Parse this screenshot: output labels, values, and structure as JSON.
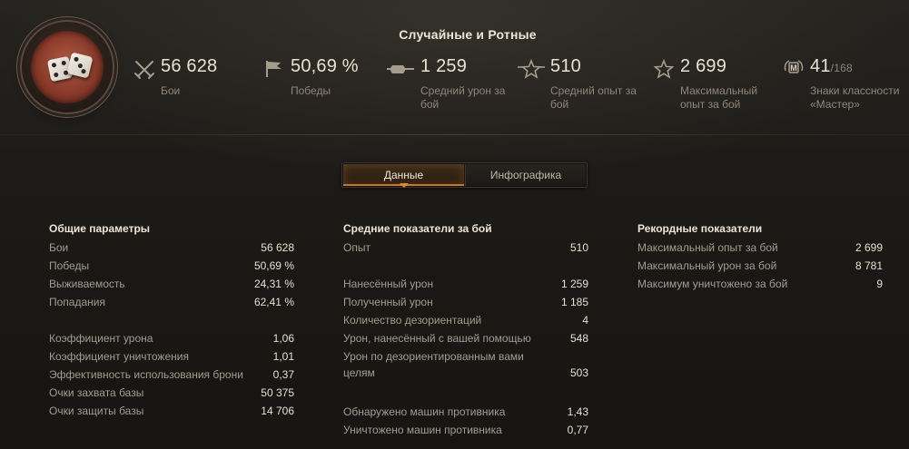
{
  "header": {
    "title": "Случайные и Ротные",
    "summary": [
      {
        "icon": "crossed-swords-icon",
        "value": "56 628",
        "label": "Бои"
      },
      {
        "icon": "flag-icon",
        "value": "50,69 %",
        "label": "Победы"
      },
      {
        "icon": "tank-gun-icon",
        "value": "1 259",
        "label": "Средний урон за бой"
      },
      {
        "icon": "star-icon",
        "value": "510",
        "label": "Средний опыт за бой"
      },
      {
        "icon": "star-outline-icon",
        "value": "2 699",
        "label": "Максимальный опыт за бой"
      },
      {
        "icon": "mastery-badge-icon",
        "value": "41",
        "sub": "/168",
        "label": "Знаки классности «Мастер»"
      }
    ]
  },
  "tabs": [
    "Данные",
    "Инфографика"
  ],
  "active_tab": "Данные",
  "general": {
    "title": "Общие параметры",
    "rows": [
      {
        "label": "Бои",
        "value": "56 628"
      },
      {
        "label": "Победы",
        "value": "50,69 %"
      },
      {
        "label": "Выживаемость",
        "value": "24,31 %"
      },
      {
        "label": "Попадания",
        "value": "62,41 %"
      },
      {
        "label": "Коэффициент урона",
        "value": "1,06"
      },
      {
        "label": "Коэффициент уничтожения",
        "value": "1,01"
      },
      {
        "label": "Эффективность использования брони",
        "value": "0,37"
      },
      {
        "label": "Очки захвата базы",
        "value": "50 375"
      },
      {
        "label": "Очки защиты базы",
        "value": "14 706"
      }
    ]
  },
  "average": {
    "title": "Средние показатели за бой",
    "rows": [
      {
        "label": "Опыт",
        "value": "510"
      },
      {
        "label": "Нанесённый урон",
        "value": "1 259"
      },
      {
        "label": "Полученный урон",
        "value": "1 185"
      },
      {
        "label": "Количество дезориентаций",
        "value": "4"
      },
      {
        "label": "Урон, нанесённый с вашей помощью",
        "value": "548"
      },
      {
        "label": "Урон по дезориентированным вами целям",
        "value": "503"
      },
      {
        "label": "Обнаружено машин противника",
        "value": "1,43"
      },
      {
        "label": "Уничтожено машин противника",
        "value": "0,77"
      }
    ]
  },
  "records": {
    "title": "Рекордные показатели",
    "rows": [
      {
        "label": "Максимальный опыт за бой",
        "value": "2 699"
      },
      {
        "label": "Максимальный урон за бой",
        "value": "8 781"
      },
      {
        "label": "Максимум уничтожено за бой",
        "value": "9"
      }
    ]
  },
  "colors": {
    "accent": "#e08a30",
    "text": "#e6e0d0",
    "muted": "#a39d8f"
  }
}
